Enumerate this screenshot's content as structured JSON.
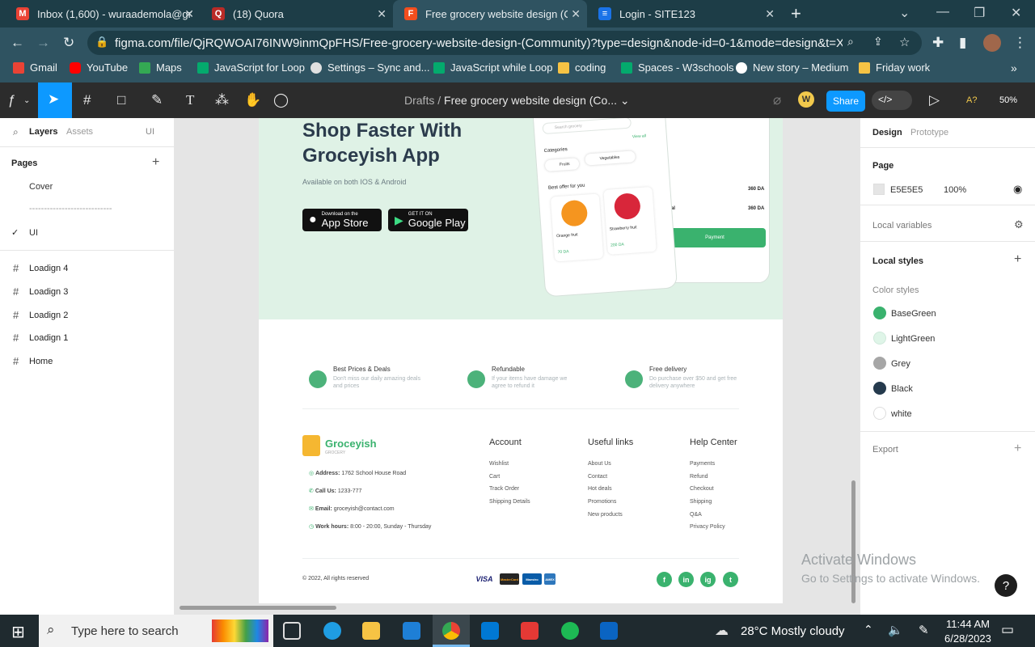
{
  "browser": {
    "tabs": [
      {
        "title": "Inbox (1,600) - wuraademola@gr",
        "icon": "gmail-icon",
        "color": "#ea4335"
      },
      {
        "title": "(18) Quora",
        "icon": "quora-icon",
        "color": "#b92b27"
      },
      {
        "title": "Free grocery website design (Cor",
        "icon": "figma-icon",
        "color": "#f24e1e"
      },
      {
        "title": "Login - SITE123",
        "icon": "site123-icon",
        "color": "#1a73e8"
      }
    ],
    "url": "figma.com/file/QjRQWOAI76INW9inmQpFHS/Free-grocery-website-design-(Community)?type=design&node-id=0-1&mode=design&t=X687J...",
    "bookmarks": [
      {
        "label": "Gmail",
        "color": "#ea4335"
      },
      {
        "label": "YouTube",
        "color": "#ff0000"
      },
      {
        "label": "Maps",
        "color": "#34a853"
      },
      {
        "label": "JavaScript for Loop",
        "color": "#04aa6d"
      },
      {
        "label": "Settings – Sync and...",
        "color": "#e0e0e0"
      },
      {
        "label": "JavaScript while Loop",
        "color": "#04aa6d"
      },
      {
        "label": "coding",
        "color": "#f6c344"
      },
      {
        "label": "Spaces - W3schools",
        "color": "#04aa6d"
      },
      {
        "label": "New story – Medium",
        "color": "#ffffff"
      },
      {
        "label": "Friday work",
        "color": "#f6c344"
      }
    ]
  },
  "figma": {
    "breadcrumb_folder": "Drafts",
    "breadcrumb_sep": "/",
    "file_title": "Free grocery website design (Co...",
    "avatar_letter": "W",
    "share_label": "Share",
    "ai_label": "A?",
    "zoom": "50%",
    "left": {
      "tab_layers": "Layers",
      "tab_assets": "Assets",
      "page_selector": "UI",
      "pages_title": "Pages",
      "pages": [
        "Cover",
        "----------------------------",
        "UI"
      ],
      "layers": [
        "Loadign 4",
        "Loadign 3",
        "Loadign 2",
        "Loadign 1",
        "Home"
      ]
    },
    "right": {
      "tab_design": "Design",
      "tab_prototype": "Prototype",
      "page_label": "Page",
      "page_color": "E5E5E5",
      "page_opacity": "100%",
      "local_variables": "Local variables",
      "local_styles": "Local styles",
      "color_styles_label": "Color styles",
      "color_styles": [
        {
          "name": "BaseGreen",
          "color": "#3ab26e"
        },
        {
          "name": "LightGreen",
          "color": "#dff5e8"
        },
        {
          "name": "Grey",
          "color": "#a6a6a6"
        },
        {
          "name": "Black",
          "color": "#253a4d"
        },
        {
          "name": "white",
          "color": "#ffffff"
        }
      ],
      "export_label": "Export"
    }
  },
  "design": {
    "hero_title": "Shop Faster With Groceyish App",
    "hero_sub": "Available on both IOS & Android",
    "appstore_small": "Download on the",
    "appstore_big": "App Store",
    "googleplay_small": "GET IT ON",
    "googleplay_big": "Google Play",
    "phone1": {
      "search": "Search grocery",
      "categories": "Categories",
      "view_all": "View all",
      "cat_fruits": "Fruits",
      "cat_veg": "Vegetables",
      "best_offer": "Best offer for you",
      "item1": "Orange fruit",
      "item1_price": "70 DA",
      "item2": "Strawberry fruit",
      "item2_price": "200 DA"
    },
    "phone2": {
      "price1": "360 DA",
      "total_label": "Total",
      "price2": "360 DA",
      "payment": "Payment"
    },
    "features": [
      {
        "title": "Best Prices & Deals",
        "sub": "Don't miss our daily amazing deals and prices"
      },
      {
        "title": "Refundable",
        "sub": "If your items have damage we agree to refund it"
      },
      {
        "title": "Free delivery",
        "sub": "Do purchase over $50 and get free delivery anywhere"
      }
    ],
    "brand": "Groceyish",
    "brand_sub": "GROCERY",
    "contact": [
      {
        "label": "Address:",
        "value": "1762 School House Road"
      },
      {
        "label": "Call Us:",
        "value": "1233-777"
      },
      {
        "label": "Email:",
        "value": "groceyish@contact.com"
      },
      {
        "label": "Work hours:",
        "value": "8:00 - 20:00, Sunday - Thursday"
      }
    ],
    "columns": [
      {
        "title": "Account",
        "links": [
          "Wishlist",
          "Cart",
          "Track Order",
          "Shipping Details"
        ]
      },
      {
        "title": "Useful links",
        "links": [
          "About Us",
          "Contact",
          "Hot deals",
          "Promotions",
          "New products"
        ]
      },
      {
        "title": "Help Center",
        "links": [
          "Payments",
          "Refund",
          "Checkout",
          "Shipping",
          "Q&A",
          "Privacy Policy"
        ]
      }
    ],
    "copyright": "© 2022, All rights reserved",
    "payments": [
      "VISA",
      "MasterCard",
      "Maestro",
      "AMEX"
    ],
    "socials": [
      "f",
      "in",
      "ig",
      "t"
    ]
  },
  "os": {
    "search_placeholder": "Type here to search",
    "weather": "28°C  Mostly cloudy",
    "time": "11:44 AM",
    "date": "6/28/2023",
    "watermark_title": "Activate Windows",
    "watermark_sub": "Go to Settings to activate Windows."
  }
}
